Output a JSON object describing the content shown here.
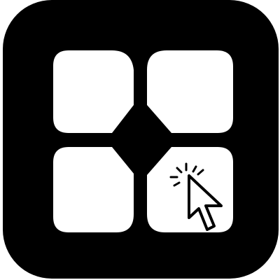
{
  "app_icon": {
    "icon": "grid-cursor-click-icon",
    "colors": {
      "tile_background": "#000000",
      "tile_foreground": "#ffffff",
      "cursor_stroke": "#000000"
    },
    "parts": [
      "tile-top-left",
      "tile-top-right",
      "tile-bottom-left",
      "tile-bottom-right",
      "center-diamond",
      "click-cursor"
    ]
  }
}
